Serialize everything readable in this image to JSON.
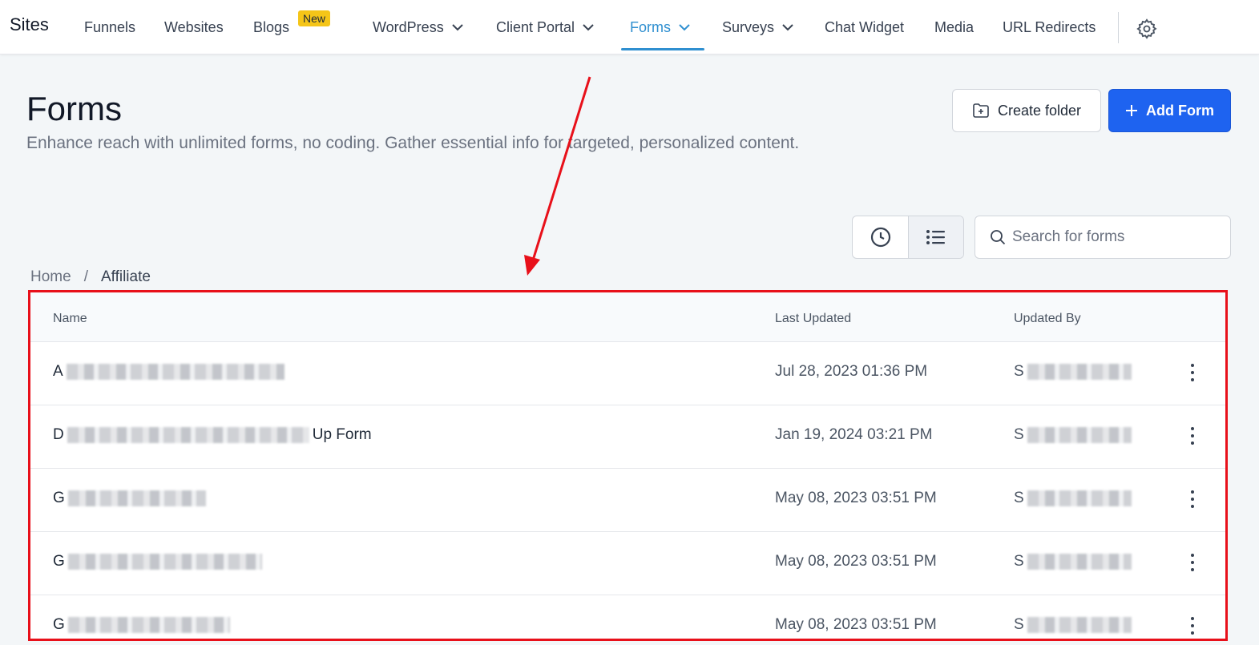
{
  "app": {
    "brand": "Sites"
  },
  "nav": {
    "items": [
      {
        "label": "Funnels",
        "has_caret": false
      },
      {
        "label": "Websites",
        "has_caret": false
      },
      {
        "label": "Blogs",
        "has_caret": false,
        "badge": "New"
      },
      {
        "label": "WordPress",
        "has_caret": true
      },
      {
        "label": "Client Portal",
        "has_caret": true
      },
      {
        "label": "Forms",
        "has_caret": true,
        "active": true
      },
      {
        "label": "Surveys",
        "has_caret": true
      },
      {
        "label": "Chat Widget",
        "has_caret": false
      },
      {
        "label": "Media",
        "has_caret": false
      },
      {
        "label": "URL Redirects",
        "has_caret": false
      }
    ],
    "settings_icon": "gear-icon"
  },
  "header": {
    "title": "Forms",
    "description": "Enhance reach with unlimited forms, no coding. Gather essential info for targeted, personalized content.",
    "create_folder_label": "Create folder",
    "add_form_label": "Add Form"
  },
  "toolbar": {
    "search_placeholder": "Search for forms",
    "view_options": [
      "clock-icon",
      "list-icon"
    ]
  },
  "breadcrumb": {
    "home": "Home",
    "separator": "/",
    "current": "Affiliate"
  },
  "table": {
    "columns": {
      "name": "Name",
      "last_updated": "Last Updated",
      "updated_by": "Updated By"
    },
    "rows": [
      {
        "name_prefix": "A",
        "name_suffix": "",
        "last_updated": "Jul 28, 2023 01:36 PM",
        "updated_by_prefix": "S"
      },
      {
        "name_prefix": "D",
        "name_suffix": "Up Form",
        "last_updated": "Jan 19, 2024 03:21 PM",
        "updated_by_prefix": "S"
      },
      {
        "name_prefix": "G",
        "name_suffix": "",
        "last_updated": "May 08, 2023 03:51 PM",
        "updated_by_prefix": "S"
      },
      {
        "name_prefix": "G",
        "name_suffix": "",
        "last_updated": "May 08, 2023 03:51 PM",
        "updated_by_prefix": "S"
      },
      {
        "name_prefix": "G",
        "name_suffix": "",
        "last_updated": "May 08, 2023 03:51 PM",
        "updated_by_prefix": "S"
      }
    ]
  },
  "colors": {
    "accent": "#2f8fd0",
    "primary_button": "#1e63f0",
    "badge": "#f5c518",
    "annotation": "#e8101a"
  }
}
